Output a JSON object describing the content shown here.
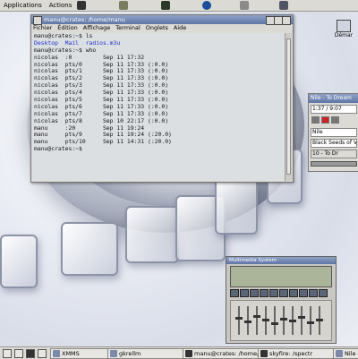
{
  "top_panel": {
    "menu": [
      "Applications",
      "Actions"
    ]
  },
  "terminal": {
    "title": "manu@crates: /home/manu",
    "menu": [
      "Fichier",
      "Édition",
      "Affichage",
      "Terminal",
      "Onglets",
      "Aide"
    ],
    "lines": [
      {
        "text": "manu@crates:~$ ls",
        "dirs": ""
      },
      {
        "text": "",
        "dirs": "Desktop  Mail  radios.m3u"
      },
      {
        "text": "manu@crates:~$ who",
        "dirs": ""
      },
      {
        "text": "nicolas  :0         Sep 11 17:32",
        "dirs": ""
      },
      {
        "text": "nicolas  pts/0      Sep 11 17:33 (:0.0)",
        "dirs": ""
      },
      {
        "text": "nicolas  pts/1      Sep 11 17:33 (:0.0)",
        "dirs": ""
      },
      {
        "text": "nicolas  pts/2      Sep 11 17:33 (:0.0)",
        "dirs": ""
      },
      {
        "text": "nicolas  pts/3      Sep 11 17:33 (:0.0)",
        "dirs": ""
      },
      {
        "text": "nicolas  pts/4      Sep 11 17:33 (:0.0)",
        "dirs": ""
      },
      {
        "text": "nicolas  pts/5      Sep 11 17:33 (:0.0)",
        "dirs": ""
      },
      {
        "text": "nicolas  pts/6      Sep 11 17:33 (:0.0)",
        "dirs": ""
      },
      {
        "text": "nicolas  pts/7      Sep 11 17:33 (:0.0)",
        "dirs": ""
      },
      {
        "text": "nicolas  pts/8      Sep 10 22:17 (:0.0)",
        "dirs": ""
      },
      {
        "text": "manu     :20        Sep 11 19:24",
        "dirs": ""
      },
      {
        "text": "manu     pts/9      Sep 11 19:24 (:20.0)",
        "dirs": ""
      },
      {
        "text": "manu     pts/10     Sep 11 14:31 (:20.0)",
        "dirs": ""
      },
      {
        "text": "manu@crates:~$ ",
        "dirs": ""
      }
    ]
  },
  "desktop_icon": {
    "label": "Démar"
  },
  "xmms": {
    "title": "Nile - To Dream",
    "time": "1:37 / 9:07",
    "artist": "Nile",
    "song": "Black Seeds of Ven",
    "track": "10 - To Dr"
  },
  "multimedia": {
    "title": "Multimedia System"
  },
  "taskbar": {
    "tasks": [
      "XMMS",
      "gkrellm",
      "manu@crates: /home/m",
      "skyfire: /spectr",
      "Nile - T"
    ]
  }
}
